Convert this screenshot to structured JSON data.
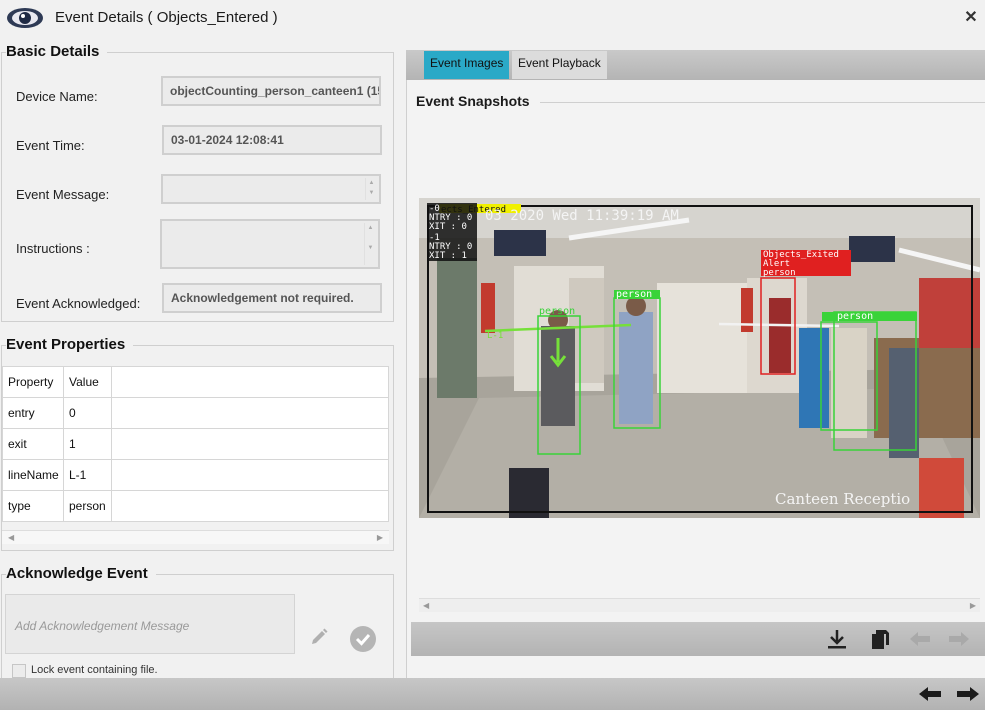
{
  "window": {
    "title": "Event Details ( Objects_Entered )"
  },
  "basic_details": {
    "title": "Basic Details",
    "device_name_label": "Device Name:",
    "device_name_value": "objectCounting_person_canteen1 (15",
    "event_time_label": "Event Time:",
    "event_time_value": "03-01-2024 12:08:41",
    "event_message_label": "Event Message:",
    "event_message_value": "",
    "instructions_label": "Instructions :",
    "instructions_value": "",
    "ack_label": "Event Acknowledged:",
    "ack_value": "Acknowledgement not required."
  },
  "event_properties": {
    "title": "Event Properties",
    "headers": [
      "Property",
      "Value"
    ],
    "rows": [
      [
        "entry",
        "0"
      ],
      [
        "exit",
        "1"
      ],
      [
        "lineName",
        "L-1"
      ],
      [
        "type",
        "person"
      ]
    ]
  },
  "acknowledge": {
    "title": "Acknowledge Event",
    "placeholder": "Add Acknowledgement Message",
    "lock_label": "Lock event containing file."
  },
  "tabs": [
    {
      "label": "Event Images",
      "active": true
    },
    {
      "label": "Event Playback",
      "active": false
    }
  ],
  "snapshots": {
    "title": "Event Snapshots",
    "overlay": {
      "banner": "ects_Entered",
      "timestamp": "03 2020 Wed 11:39:19 AM",
      "counter1_entry": "NTRY : 0",
      "counter1_exit": "XIT : 0",
      "counter1_head": "-0",
      "counter2_head": "-1",
      "counter2_entry": "NTRY : 0",
      "counter2_exit": "XIT : 1",
      "line_label": "L-1",
      "alert_line1": "Objects_Exited",
      "alert_line2": "Alert",
      "alert_box_label": "person",
      "person_label": "person",
      "camera_name": "Canteen Receptio"
    }
  },
  "colors": {
    "tab_active": "#2aa9c7",
    "detection_box": "#39d339",
    "alert_box": "#e02020",
    "banner": "#f0f000"
  },
  "icons": [
    "app-eye-icon",
    "close-icon",
    "pencil-icon",
    "check-icon",
    "download-icon",
    "copy-icon",
    "arrow-left-icon",
    "arrow-right-icon"
  ]
}
